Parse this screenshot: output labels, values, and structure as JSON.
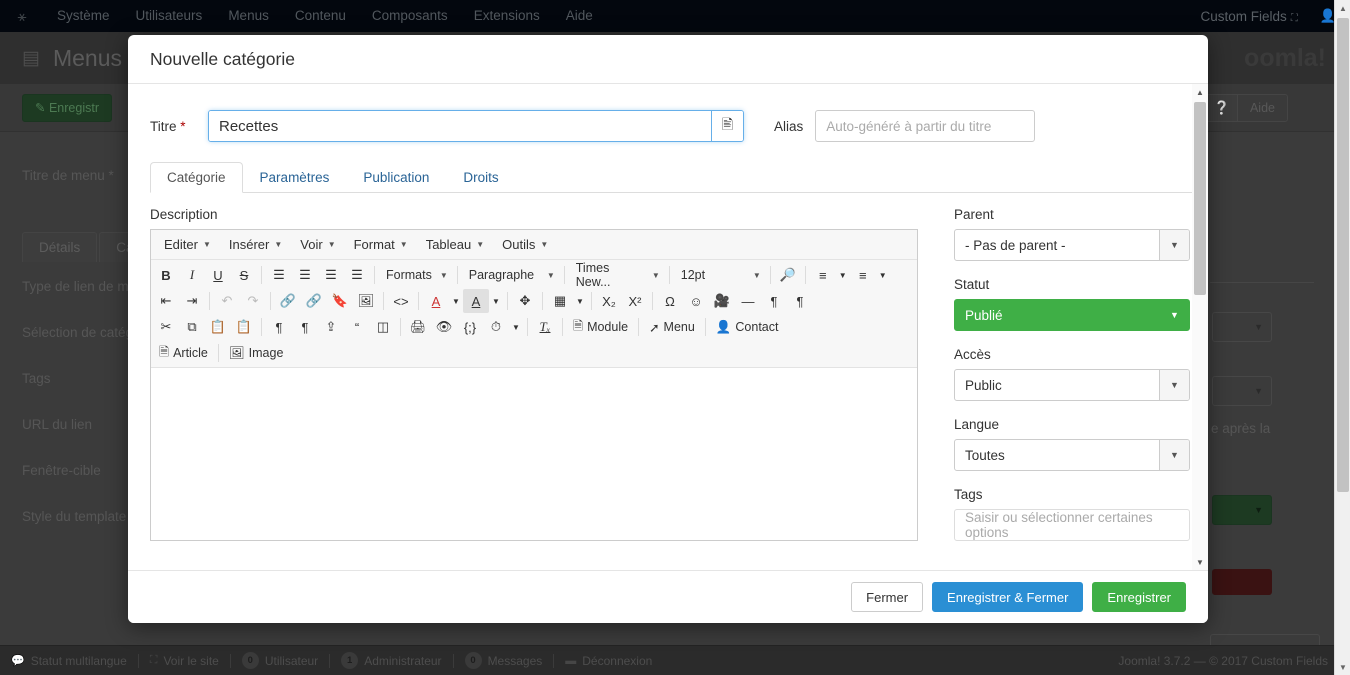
{
  "topbar": {
    "logo_icon": "joomla-logo-icon",
    "nav": [
      "Système",
      "Utilisateurs",
      "Menus",
      "Contenu",
      "Composants",
      "Extensions",
      "Aide"
    ],
    "site_name": "Custom Fields",
    "external_icon": "external-link-icon",
    "user_icon": "user-icon"
  },
  "subheader": {
    "icon": "menu-grid-icon",
    "title": "Menus",
    "brand": "oomla!"
  },
  "page_toolbar": {
    "save_label": "Enregistr",
    "help_label": "Aide",
    "help_icon": "question-circle-icon"
  },
  "background_form": {
    "menu_title_label": "Titre de menu *",
    "tabs": [
      "Détails",
      "Caté"
    ],
    "labels": [
      "Type de lien de me",
      "Sélection de catég",
      "Tags",
      "URL du lien",
      "Fenêtre-cible",
      "Style du template"
    ],
    "fragment_text": "e après la"
  },
  "modal": {
    "title": "Nouvelle catégorie",
    "title_field": {
      "label": "Titre",
      "required_mark": "*",
      "value": "Recettes",
      "button_icon": "article-picker-icon"
    },
    "alias_field": {
      "label": "Alias",
      "value": "",
      "placeholder": "Auto-généré à partir du titre"
    },
    "tabs": [
      {
        "label": "Catégorie",
        "active": true
      },
      {
        "label": "Paramètres",
        "active": false
      },
      {
        "label": "Publication",
        "active": false
      },
      {
        "label": "Droits",
        "active": false
      }
    ],
    "description_label": "Description",
    "editor": {
      "menus": [
        "Editer",
        "Insérer",
        "Voir",
        "Format",
        "Tableau",
        "Outils"
      ],
      "row1": {
        "bold": "B",
        "italic": "I",
        "underline": "U",
        "strikethrough": "S",
        "align_left_icon": "align-left-icon",
        "align_center_icon": "align-center-icon",
        "align_right_icon": "align-right-icon",
        "align_justify_icon": "align-justify-icon",
        "formats_label": "Formats",
        "block_label": "Paragraphe",
        "font_label": "Times New...",
        "size_label": "12pt",
        "search_icon": "search-replace-icon",
        "bullet_list_icon": "bullet-list-icon",
        "numbered_list_icon": "numbered-list-icon"
      },
      "row2": {
        "outdent_icon": "outdent-icon",
        "indent_icon": "indent-icon",
        "undo_icon": "undo-icon",
        "redo_icon": "redo-icon",
        "link_icon": "link-icon",
        "unlink_icon": "unlink-icon",
        "anchor_icon": "anchor-bookmark-icon",
        "image_icon": "image-icon",
        "code_icon": "source-code-icon",
        "text_color_icon": "text-color-icon",
        "background_color_icon": "background-color-icon",
        "fullscreen_icon": "fullscreen-icon",
        "table_icon": "table-icon",
        "subscript_icon": "subscript-icon",
        "superscript_icon": "superscript-icon",
        "charmap_icon": "special-character-icon",
        "emoticon_icon": "emoticon-icon",
        "media_icon": "media-icon",
        "hr_icon": "horizontal-rule-icon",
        "ltr_icon": "ltr-icon",
        "rtl_icon": "rtl-icon"
      },
      "row3": {
        "cut_icon": "cut-icon",
        "copy_icon": "copy-icon",
        "paste_icon": "paste-icon",
        "paste_text_icon": "paste-as-text-icon",
        "visualchars_icon": "show-invisible-characters-icon",
        "pagebreak_icon": "page-break-icon",
        "template_icon": "insert-template-icon",
        "blockquote_icon": "blockquote-icon",
        "visualblocks_icon": "show-blocks-icon",
        "print_icon": "print-icon",
        "preview_icon": "preview-icon",
        "sourcecode_icon": "code-sample-icon",
        "insertdatetime_icon": "insert-date-time-icon",
        "removeformat_icon": "remove-formatting-icon",
        "module_label": "Module",
        "module_icon": "module-icon",
        "menu_label": "Menu",
        "menu_icon": "menu-link-icon",
        "contact_label": "Contact",
        "contact_icon": "contact-icon"
      },
      "row4": {
        "article_label": "Article",
        "article_icon": "article-icon",
        "image_label": "Image",
        "image_icon": "image-icon"
      },
      "content": ""
    },
    "sidebar": {
      "parent": {
        "label": "Parent",
        "value": "- Pas de parent -"
      },
      "status": {
        "label": "Statut",
        "value": "Publié",
        "color": "#3faf46"
      },
      "access": {
        "label": "Accès",
        "value": "Public"
      },
      "language": {
        "label": "Langue",
        "value": "Toutes"
      },
      "tags": {
        "label": "Tags",
        "value": "",
        "placeholder": "Saisir ou sélectionner certaines options"
      }
    },
    "footer_buttons": {
      "close": "Fermer",
      "save_close": "Enregistrer & Fermer",
      "save": "Enregistrer"
    }
  },
  "footer": {
    "multilang_label": "Statut multilangue",
    "multilang_icon": "comment-icon",
    "view_site_label": "Voir le site",
    "view_site_icon": "external-link-icon",
    "users_count": "0",
    "users_label": "Utilisateur",
    "admins_count": "1",
    "admins_label": "Administrateur",
    "messages_count": "0",
    "messages_label": "Messages",
    "logout_label": "Déconnexion",
    "logout_icon": "logout-icon",
    "copyright": "Joomla! 3.7.2  —  © 2017 Custom Fields"
  }
}
